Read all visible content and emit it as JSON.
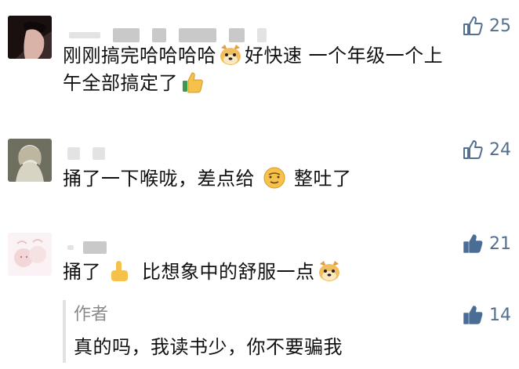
{
  "comments": [
    {
      "likes": "25",
      "text_line1": "刚刚搞完哈哈哈哈",
      "text_line1b": "好快速 一个年级一个上",
      "text_line2": "午全部搞定了"
    },
    {
      "likes": "24",
      "text_a": "捅了一下喉咙，差点给",
      "text_b": "整吐了"
    },
    {
      "likes": "21",
      "text_a": "捅了",
      "text_b": "比想象中的舒服一点"
    }
  ],
  "reply": {
    "label": "作者",
    "likes": "14",
    "text": "真的吗，我读书少，你不要骗我"
  },
  "colors": {
    "like_outline": "#55708f",
    "like_filled": "#4a6d96",
    "reply_bar": "#e2e2e2"
  },
  "icons": [
    "thumbs-up-outline-icon",
    "thumbs-up-filled-icon",
    "doge-emoji",
    "thumbs-up-emoji",
    "smile-face-emoji",
    "finger-emoji"
  ]
}
